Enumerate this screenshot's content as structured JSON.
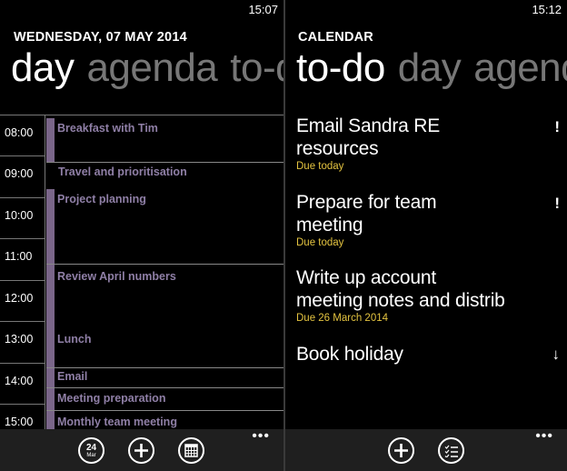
{
  "left": {
    "status_time": "15:07",
    "header": "WEDNESDAY, 07 MAY 2014",
    "pivots": [
      "day",
      "agenda",
      "to-do"
    ],
    "hours": [
      "08:00",
      "09:00",
      "10:00",
      "11:00",
      "12:00",
      "13:00",
      "14:00",
      "15:00"
    ],
    "events": [
      {
        "title": "Breakfast with Tim"
      },
      {
        "title": "Travel and prioritisation"
      },
      {
        "title": "Project planning"
      },
      {
        "title": "Review April numbers"
      },
      {
        "title": "Lunch"
      },
      {
        "title": "Email"
      },
      {
        "title": "Meeting preparation"
      },
      {
        "title": "Monthly team meeting"
      }
    ],
    "appbar": {
      "date_day": "24",
      "date_month": "Mar",
      "icons": [
        "calendar-date-icon",
        "add-icon",
        "month-view-icon",
        "more-icon"
      ],
      "more": "•••"
    }
  },
  "right": {
    "status_time": "15:12",
    "header": "CALENDAR",
    "pivots": [
      "to-do",
      "day",
      "agenda"
    ],
    "todos": [
      {
        "title_line1": "Email Sandra RE",
        "title_line2": "resources",
        "due": "Due today",
        "mark": "!"
      },
      {
        "title_line1": "Prepare for team",
        "title_line2": "meeting",
        "due": "Due today",
        "mark": "!"
      },
      {
        "title_line1": "Write up account",
        "title_line2": "meeting notes and distrib",
        "due": "Due 26 March 2014",
        "mark": ""
      },
      {
        "title_line1": "Book holiday",
        "title_line2": "",
        "due": "",
        "mark": "↓"
      }
    ],
    "appbar": {
      "icons": [
        "add-icon",
        "list-icon",
        "more-icon"
      ],
      "more": "•••"
    }
  }
}
